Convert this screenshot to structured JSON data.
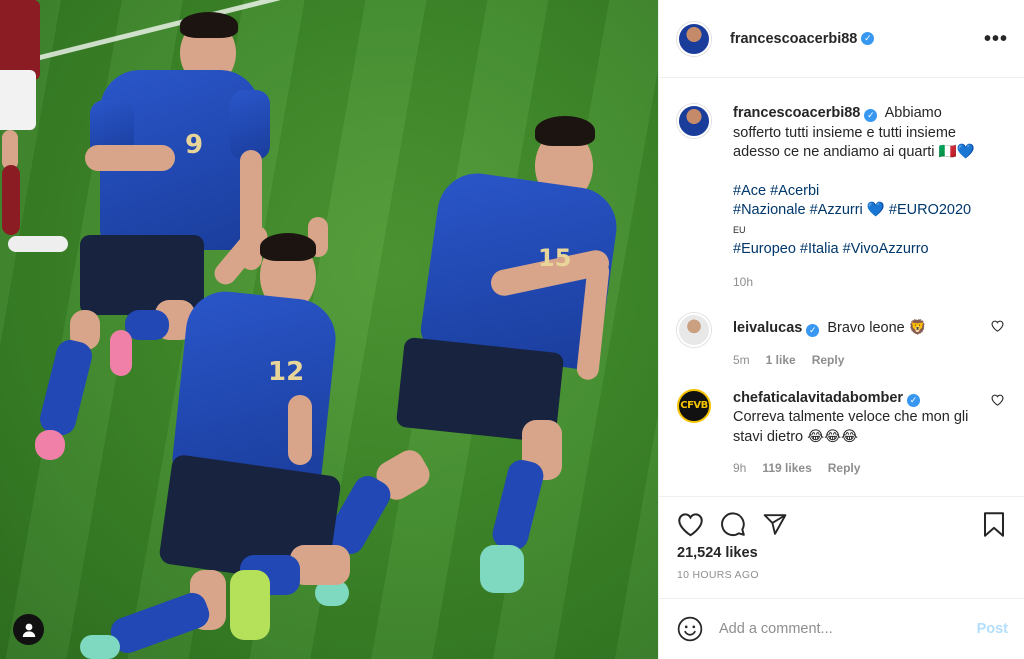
{
  "post": {
    "author": "francescoacerbi88",
    "more_icon": "•••",
    "caption": {
      "author": "francescoacerbi88",
      "text": "Abbiamo sofferto tutti insieme e tutti insieme adesso ce ne andiamo ai quarti 🇮🇹",
      "heart": "💙",
      "tags_line1": "#Ace #Acerbi",
      "tags_line2a": "#Nazionale #Azzurri",
      "tags_line2_heart": "💙",
      "tags_line2b": "#EURO2020",
      "eu_flag": "EU",
      "tags_line3": "#Europeo #Italia #VivoAzzurro",
      "time": "10h"
    },
    "comments": [
      {
        "author": "leivalucas",
        "text": "Bravo leone 🦁",
        "time": "5m",
        "likes": "1 like",
        "reply": "Reply"
      },
      {
        "author": "chefaticalavitadabomber",
        "avatar_text": "CFVB",
        "text": "Correva talmente veloce che mon gli stavi dietro 😂😂😂",
        "time": "9h",
        "likes": "119 likes",
        "reply": "Reply"
      }
    ],
    "likes": "21,524 likes",
    "time_ago": "10 HOURS AGO",
    "add_comment_placeholder": "Add a comment...",
    "post_button": "Post"
  },
  "photo": {
    "jersey_numbers": [
      "9",
      "12",
      "15"
    ]
  },
  "colors": {
    "link": "#00376b",
    "verified": "#3897f0",
    "muted": "#8e8e8e",
    "post_disabled": "#b2dffc"
  }
}
